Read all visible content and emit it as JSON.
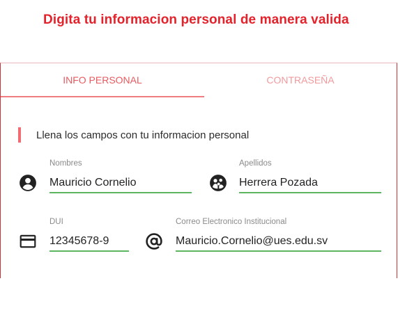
{
  "page": {
    "heading": "Digita tu informacion personal de manera valida",
    "accent_color": "#e3222b",
    "valid_underline_color": "#5cb660"
  },
  "tabs": [
    {
      "label": "INFO PERSONAL",
      "active": true
    },
    {
      "label": "CONTRASEÑA",
      "active": false
    }
  ],
  "section": {
    "title": "Llena los campos con tu informacion personal"
  },
  "fields": {
    "nombres": {
      "label": "Nombres",
      "value": "Mauricio Cornelio",
      "icon": "account-circle-icon"
    },
    "apellidos": {
      "label": "Apellidos",
      "value": "Herrera Pozada",
      "icon": "family-group-icon"
    },
    "dui": {
      "label": "DUI",
      "value": "12345678-9",
      "icon": "credit-card-icon"
    },
    "correo": {
      "label": "Correo Electronico Institucional",
      "value": "Mauricio.Cornelio@ues.edu.sv",
      "icon": "at-sign-icon"
    }
  }
}
